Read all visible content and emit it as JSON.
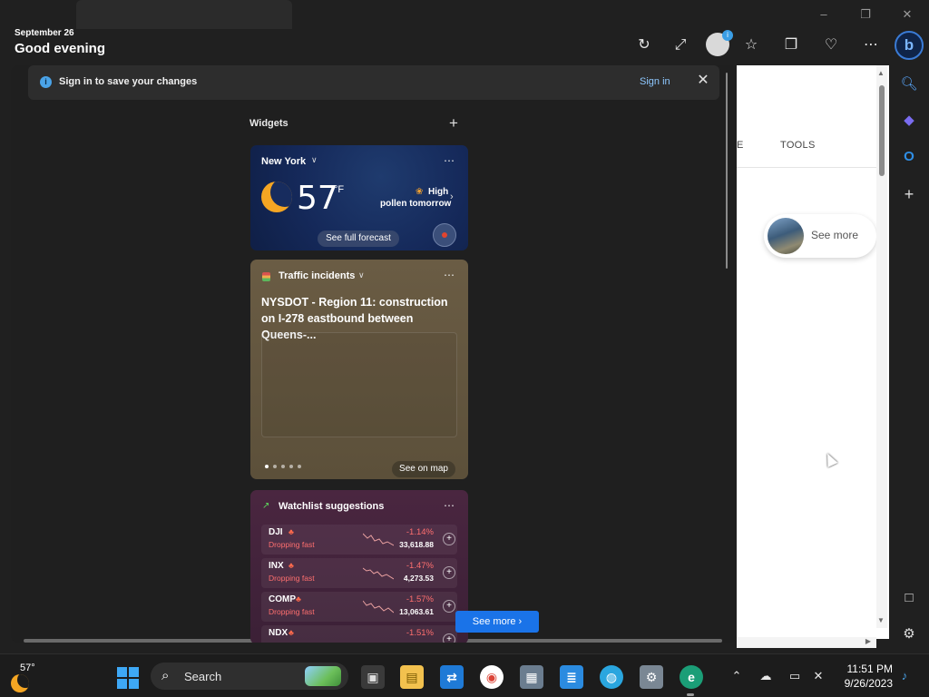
{
  "header": {
    "date": "September 26",
    "greeting": "Good evening"
  },
  "signin_bar": {
    "message": "Sign in to save your changes",
    "link": "Sign in"
  },
  "widgets": {
    "title": "Widgets"
  },
  "weather": {
    "location": "New York",
    "temperature": "57",
    "unit": "°F",
    "pollen_level": "High",
    "pollen_desc": "pollen tomorrow",
    "forecast_button": "See full forecast"
  },
  "traffic": {
    "title": "Traffic incidents",
    "headline": "NYSDOT - Region 11: construction on I-278 eastbound between Queens-...",
    "map_button": "See on map",
    "pages": 5,
    "active_page": 1
  },
  "watchlist": {
    "title": "Watchlist suggestions",
    "rows": [
      {
        "symbol": "DJI",
        "status": "Dropping fast",
        "change": "-1.14%",
        "value": "33,618.88"
      },
      {
        "symbol": "INX",
        "status": "Dropping fast",
        "change": "-1.47%",
        "value": "4,273.53"
      },
      {
        "symbol": "COMP",
        "status": "Dropping fast",
        "change": "-1.57%",
        "value": "13,063.61"
      },
      {
        "symbol": "NDX",
        "status": "",
        "change": "-1.51%",
        "value": ""
      }
    ],
    "see_more": "See more"
  },
  "browser_page": {
    "tools_tab": "TOOLS",
    "partial_tab": "E",
    "see_more": "See more"
  },
  "taskbar": {
    "weather_temp": "57°",
    "search_placeholder": "Search",
    "time": "11:51 PM",
    "date": "9/26/2023"
  },
  "icons": {
    "refresh": "refresh-icon",
    "expand": "expand-icon",
    "favorites": "favorites-icon",
    "collections": "collections-icon",
    "health": "browser-essentials-icon",
    "more": "more-icon",
    "bing": "bing-copilot-icon"
  },
  "colors": {
    "accent": "#1a73e8",
    "link": "#8ec8ff",
    "negative": "#ff6f6f"
  }
}
